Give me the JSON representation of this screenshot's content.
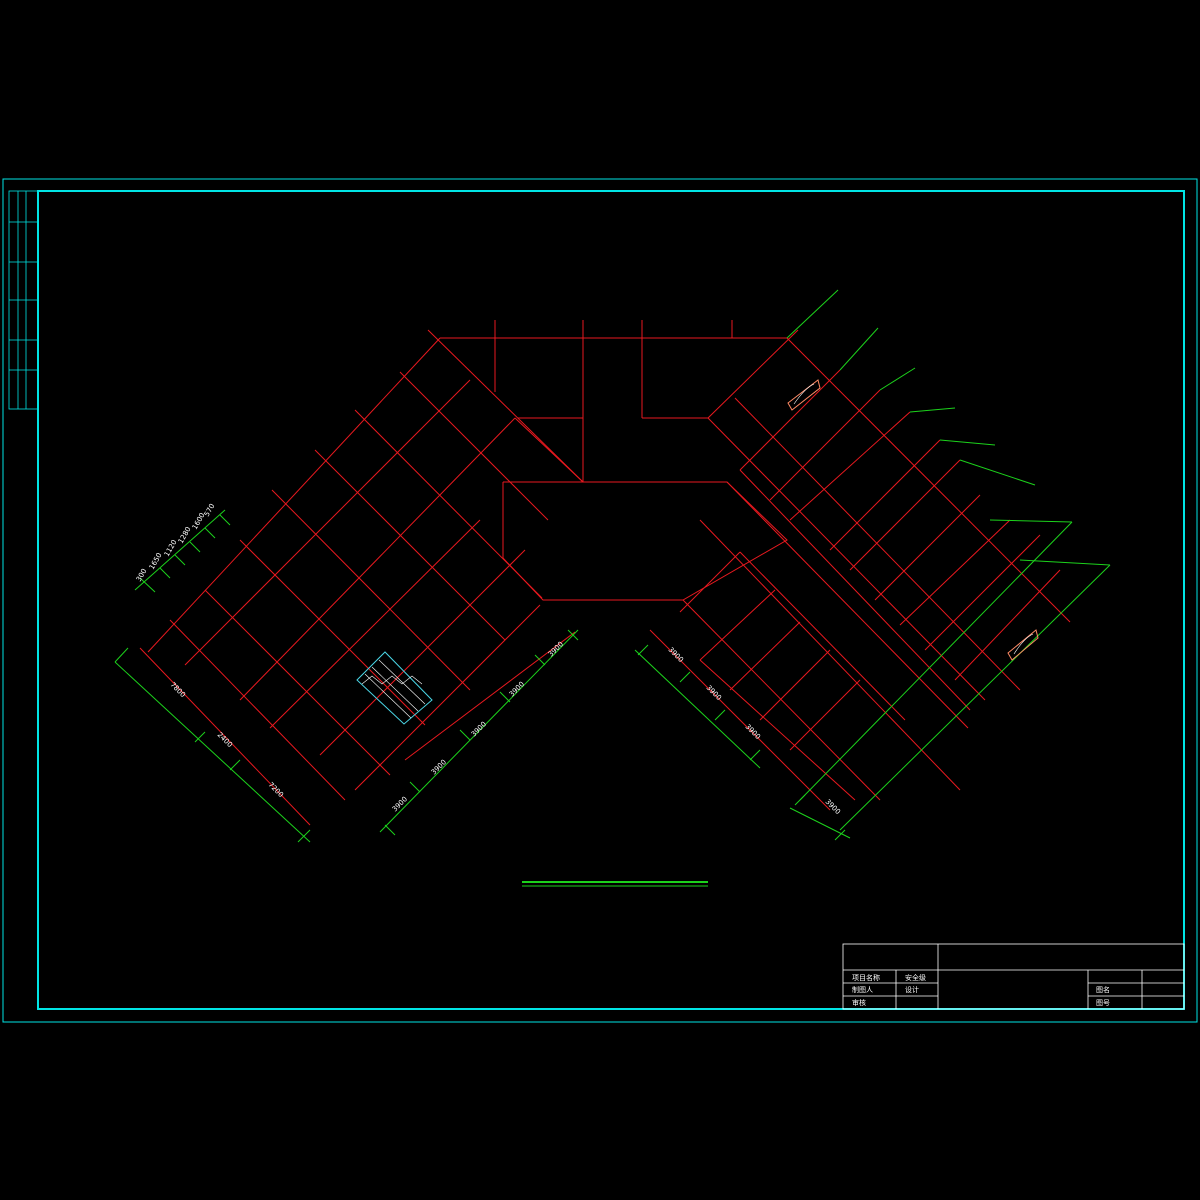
{
  "colors": {
    "frame": "#00e5e5",
    "structure": "#e8191f",
    "dimension": "#1cd21c",
    "stair": "#4ad6e6",
    "fixture": "#ff8a65",
    "text": "#ffffff",
    "background": "#000000"
  },
  "left_wing_dimensions": {
    "outer": [
      "7800",
      "2400",
      "7200"
    ],
    "inner": [
      "3900",
      "3900",
      "3900",
      "3900",
      "3900"
    ],
    "end": [
      "300",
      "1650",
      "1120",
      "1280",
      "1600",
      "570"
    ]
  },
  "right_wing_dimensions": {
    "inner": [
      "3900",
      "3900",
      "3900"
    ],
    "outer": [
      "3900"
    ]
  },
  "title_block": {
    "project_name_label": "项目名称",
    "safety_label": "安全级",
    "drawer_label": "制图人",
    "design_label": "设计",
    "review_label": "审核",
    "drawing_name_label": "图名",
    "drawing_no_label": "图号"
  },
  "icons": [
    "stair-icon",
    "fixture-icon"
  ]
}
